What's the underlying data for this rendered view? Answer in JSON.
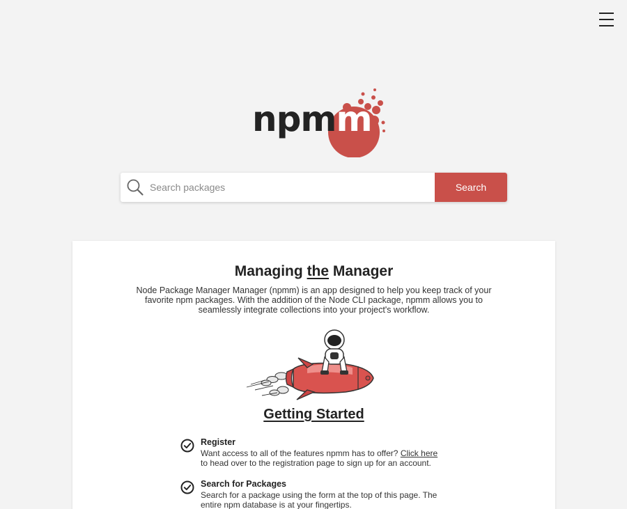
{
  "header": {
    "menu_icon": "hamburger-menu-icon"
  },
  "logo": {
    "text_main": "npm",
    "text_accent": "m",
    "accent_color": "#c9504a"
  },
  "search": {
    "placeholder": "Search packages",
    "value": "",
    "button_label": "Search",
    "icon": "search-icon"
  },
  "card": {
    "title_before": "Managing ",
    "title_emphasis": "the",
    "title_after": " Manager",
    "intro": "Node Package Manager Manager (npmm) is an app designed to help you keep track of your favorite npm packages. With the addition of the Node CLI package, npmm allows you to seamlessly integrate collections into your project's workflow.",
    "illustration": "astronaut-on-rocket",
    "getting_started": "Getting Started",
    "steps": [
      {
        "title": "Register",
        "body_before": "Want access to all of the features npmm has to offer? ",
        "link": "Click here",
        "body_after": " to head over to the registration page to sign up for an account.",
        "icon": "check-circle-icon"
      },
      {
        "title": "Search for Packages",
        "body_before": "Search for a package using the form at the top of this page. The entire npm database is at your fingertips.",
        "link": "",
        "body_after": "",
        "icon": "check-circle-icon"
      }
    ]
  },
  "colors": {
    "background": "#f3f3f3",
    "accent": "#c9504a",
    "text": "#222222"
  }
}
